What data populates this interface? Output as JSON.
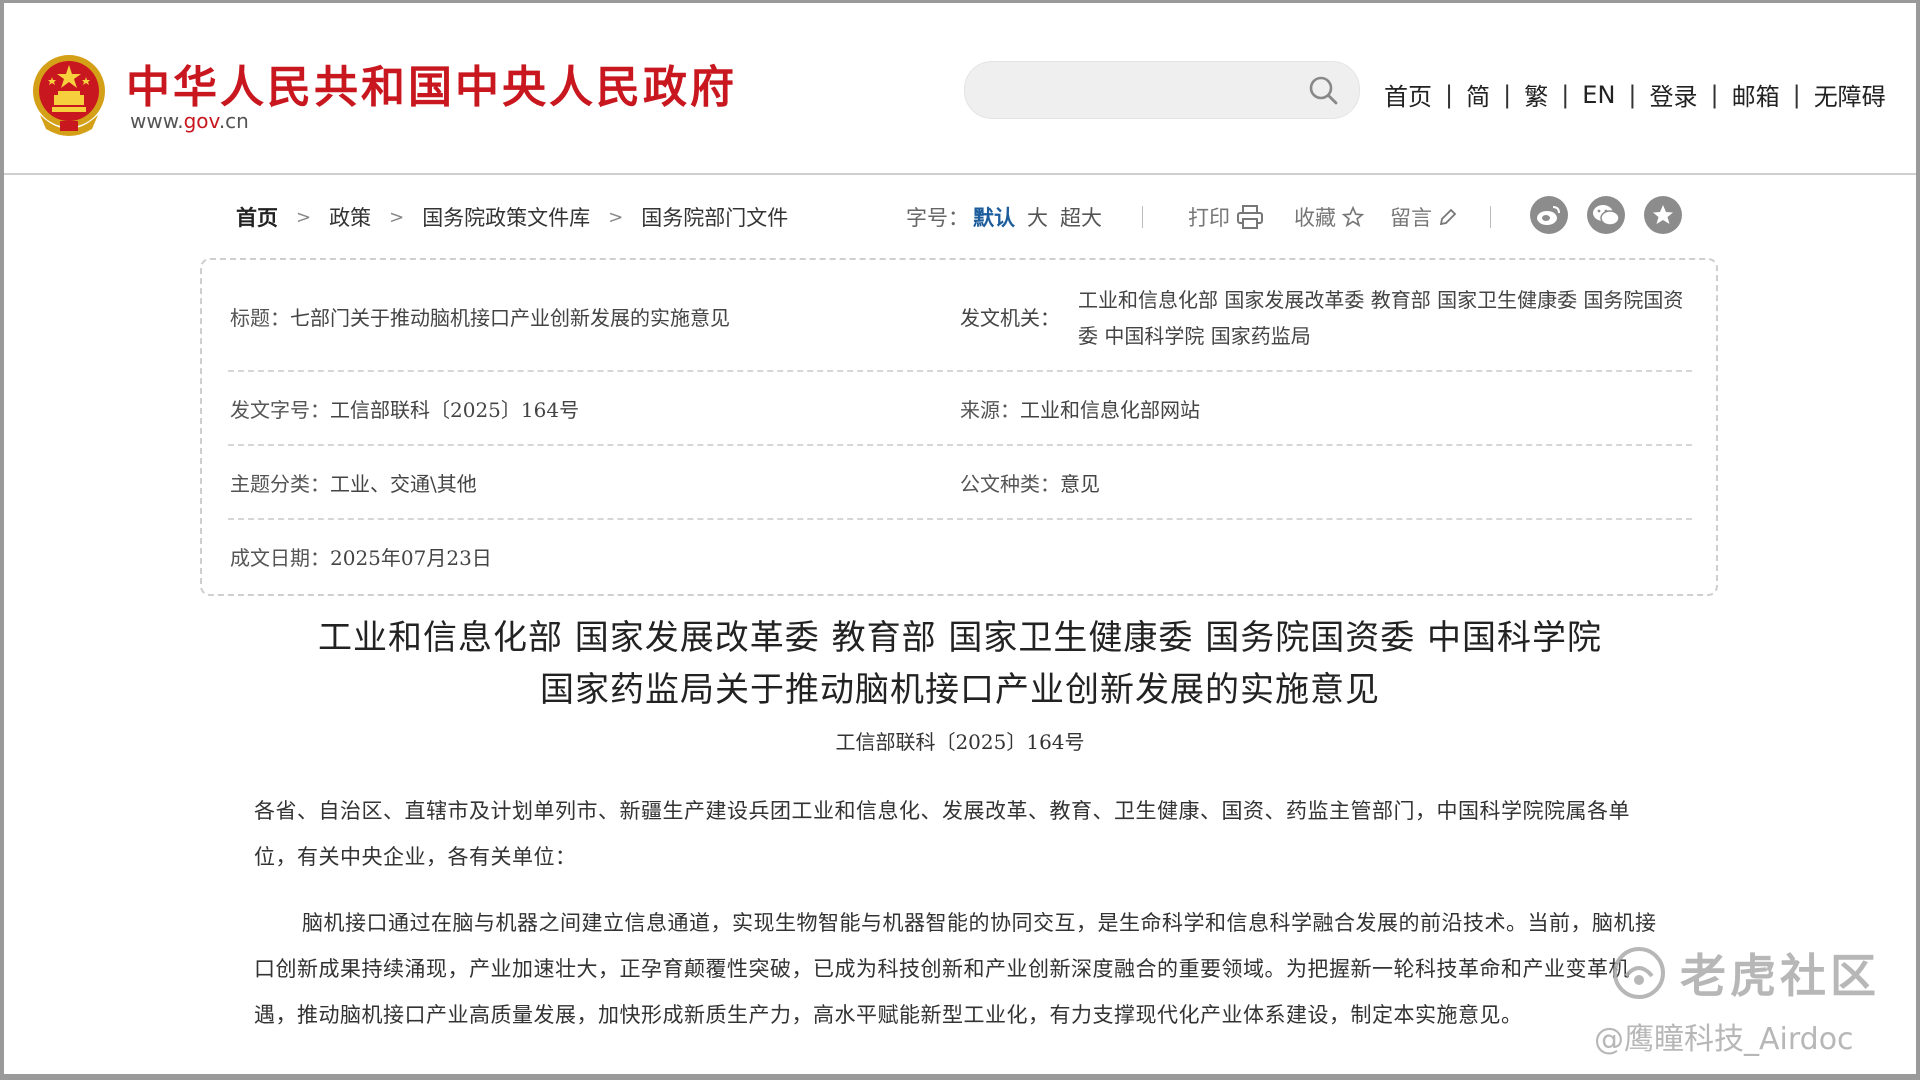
{
  "header": {
    "site_title": "中华人民共和国中央人民政府",
    "site_url_prefix": "www.",
    "site_url_brand": "gov",
    "site_url_suffix": ".cn",
    "search_placeholder": "",
    "nav": [
      "首页",
      "简",
      "繁",
      "EN",
      "登录",
      "邮箱",
      "无障碍"
    ]
  },
  "toolbar": {
    "breadcrumbs": [
      "首页",
      "政策",
      "国务院政策文件库",
      "国务院部门文件"
    ],
    "font_size_label": "字号：",
    "font_size_options": [
      "默认",
      "大",
      "超大"
    ],
    "font_size_active": "默认",
    "print_label": "打印",
    "favorite_label": "收藏",
    "comment_label": "留言"
  },
  "info": {
    "title_label": "标题：",
    "title_value": "七部门关于推动脑机接口产业创新发展的实施意见",
    "issuer_label": "发文机关：",
    "issuer_value": "工业和信息化部 国家发展改革委 教育部 国家卫生健康委 国务院国资委 中国科学院 国家药监局",
    "docno_label": "发文字号：",
    "docno_value": "工信部联科〔2025〕164号",
    "source_label": "来源：",
    "source_value": "工业和信息化部网站",
    "topic_label": "主题分类：",
    "topic_value": "工业、交通\\其他",
    "doctype_label": "公文种类：",
    "doctype_value": "意见",
    "date_label": "成文日期：",
    "date_value": "2025年07月23日"
  },
  "document": {
    "title_line1": "工业和信息化部 国家发展改革委 教育部 国家卫生健康委 国务院国资委 中国科学院",
    "title_line2": "国家药监局关于推动脑机接口产业创新发展的实施意见",
    "number": "工信部联科〔2025〕164号",
    "salutation": "各省、自治区、直辖市及计划单列市、新疆生产建设兵团工业和信息化、发展改革、教育、卫生健康、国资、药监主管部门，中国科学院院属各单位，有关中央企业，各有关单位：",
    "paragraph1": "脑机接口通过在脑与机器之间建立信息通道，实现生物智能与机器智能的协同交互，是生命科学和信息科学融合发展的前沿技术。当前，脑机接口创新成果持续涌现，产业加速壮大，正孕育颠覆性突破，已成为科技创新和产业创新深度融合的重要领域。为把握新一轮科技革命和产业变革机遇，推动脑机接口产业高质量发展，加快形成新质生产力，高水平赋能新型工业化，有力支撑现代化产业体系建设，制定本实施意见。"
  },
  "watermark": {
    "line1": "老虎社区",
    "line2": "@鹰瞳科技_Airdoc"
  },
  "colors": {
    "brand_red": "#c8171e",
    "active_blue": "#1d5d9b",
    "share_grey": "#8c8c8c"
  }
}
